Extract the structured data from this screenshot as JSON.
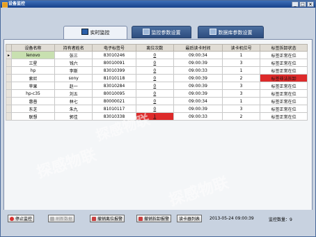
{
  "window": {
    "title": "设备监控"
  },
  "tabs": [
    {
      "label": "实时监控",
      "active": true
    },
    {
      "label": "监控参数设置",
      "active": false
    },
    {
      "label": "数据库参数设置",
      "active": false
    }
  ],
  "table": {
    "columns": [
      "设备名称",
      "持有者姓名",
      "电子标签号",
      "离位次数",
      "最后读卡时间",
      "读卡机位号",
      "标签拆卸状态"
    ],
    "rows": [
      [
        "lenovo",
        "张三",
        "83010246",
        "0",
        "09:00:34",
        "1",
        "标签正常在位"
      ],
      [
        "三星",
        "钱六",
        "80010091",
        "0",
        "09:00:39",
        "3",
        "标签正常在位"
      ],
      [
        "hp",
        "李斯",
        "83010399",
        "0",
        "09:00:33",
        "1",
        "标签正常在位"
      ],
      [
        "索尼",
        "sony",
        "81010118",
        "0",
        "09:00:39",
        "2",
        "标签非法拆卸"
      ],
      [
        "苹果",
        "赵一",
        "83010284",
        "0",
        "09:00:39",
        "3",
        "标签正常在位"
      ],
      [
        "hp-c35",
        "刘五",
        "80010095",
        "0",
        "09:00:39",
        "3",
        "标签正常在位"
      ],
      [
        "惠普",
        "林七",
        "80000021",
        "0",
        "09:00:34",
        "1",
        "标签正常在位"
      ],
      [
        "东芝",
        "朱九",
        "81010117",
        "0",
        "09:00:39",
        "3",
        "标签正常在位"
      ],
      [
        "联想",
        "郭佳",
        "83010338",
        "1",
        "09:00:33",
        "2",
        "标签正常在位"
      ]
    ],
    "alerts": {
      "offpos_row": 8,
      "illegal_row": 3
    }
  },
  "toolbar": {
    "stop": "停止监控",
    "refresh": "刷新数据",
    "cancel_offpos": "撤销离位报警",
    "cancel_remove": "撤销拆卸报警",
    "reader_list": "读卡器列表"
  },
  "status": {
    "datetime": "2013-05-24 09:00:39",
    "count_label": "监控数量：9"
  },
  "watermark": {
    "text": "探感物联"
  },
  "colors": {
    "alert_red": "#dd2a2a",
    "selected_green": "#c8e0b0",
    "title_blue": "#16418b"
  }
}
